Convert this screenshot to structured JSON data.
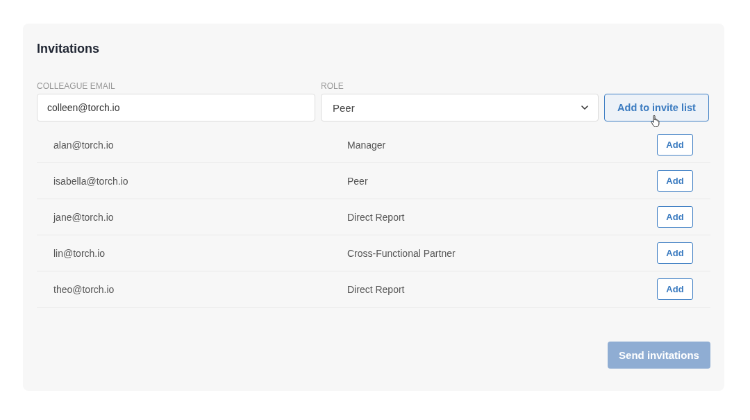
{
  "title": "Invitations",
  "form": {
    "email": {
      "label": "COLLEAGUE EMAIL",
      "value": "colleen@torch.io"
    },
    "role": {
      "label": "ROLE",
      "value": "Peer"
    },
    "add_button": {
      "label": "Add to invite list",
      "hovered": true
    }
  },
  "suggestions": [
    {
      "email": "alan@torch.io",
      "role": "Manager",
      "button": "Add"
    },
    {
      "email": "isabella@torch.io",
      "role": "Peer",
      "button": "Add"
    },
    {
      "email": "jane@torch.io",
      "role": "Direct Report",
      "button": "Add"
    },
    {
      "email": "lin@torch.io",
      "role": "Cross-Functional Partner",
      "button": "Add"
    },
    {
      "email": "theo@torch.io",
      "role": "Direct Report",
      "button": "Add"
    }
  ],
  "send_button": {
    "label": "Send invitations",
    "disabled": true
  }
}
